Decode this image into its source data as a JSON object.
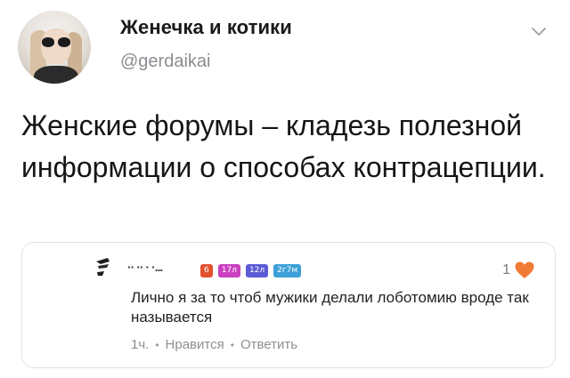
{
  "tweet": {
    "author_name": "Женечка и котики",
    "author_handle": "@gerdaikai",
    "text": "Женские форумы – кладезь полезной информации о способах контрацепции.",
    "menu_icon": "chevron-down-icon"
  },
  "quoted_comment": {
    "author_name": "·· ·· · ·...",
    "badges": [
      {
        "label": "6",
        "color": "#e0522f"
      },
      {
        "label": "17л",
        "color": "#c940c0"
      },
      {
        "label": "12л",
        "color": "#5c5bd6"
      },
      {
        "label": "2г7м",
        "color": "#3ea0d8"
      }
    ],
    "like_count": "1",
    "like_icon": "heart-icon",
    "like_color": "#f07a36",
    "text": "Лично я за то чтоб мужики делали лоботомию вроде так называется",
    "time": "1ч.",
    "separator": "•",
    "like_action": "Нравится",
    "reply_action": "Ответить"
  }
}
